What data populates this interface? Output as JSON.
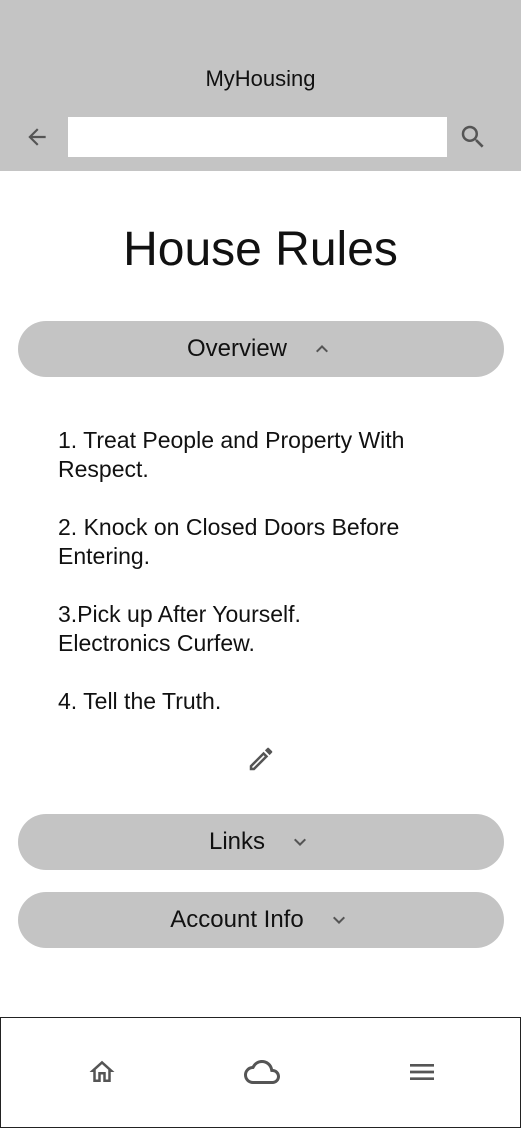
{
  "app": {
    "title": "MyHousing"
  },
  "header": {
    "search_value": "",
    "back_icon": "arrow-left-icon",
    "search_icon": "search-icon"
  },
  "page": {
    "title": "House Rules"
  },
  "sections": {
    "overview": {
      "label": "Overview",
      "expanded": true,
      "chevron_icon": "chevron-up-icon"
    },
    "links": {
      "label": "Links",
      "expanded": false,
      "chevron_icon": "chevron-down-icon"
    },
    "account_info": {
      "label": "Account Info",
      "expanded": false,
      "chevron_icon": "chevron-down-icon"
    }
  },
  "rules": [
    "1. Treat People and Property With Respect.",
    "2. Knock on Closed Doors Before Entering.",
    "3.Pick up After Yourself.\nElectronics Curfew.",
    "4. Tell the Truth."
  ],
  "edit_icon": "pencil-icon",
  "bottom_nav": {
    "items": [
      {
        "icon": "home-icon"
      },
      {
        "icon": "cloud-icon"
      },
      {
        "icon": "menu-icon"
      }
    ]
  },
  "colors": {
    "header_bg": "#c4c4c4",
    "pill_bg": "#c4c4c4",
    "icon": "#555555",
    "text": "#111111",
    "background": "#ffffff"
  }
}
